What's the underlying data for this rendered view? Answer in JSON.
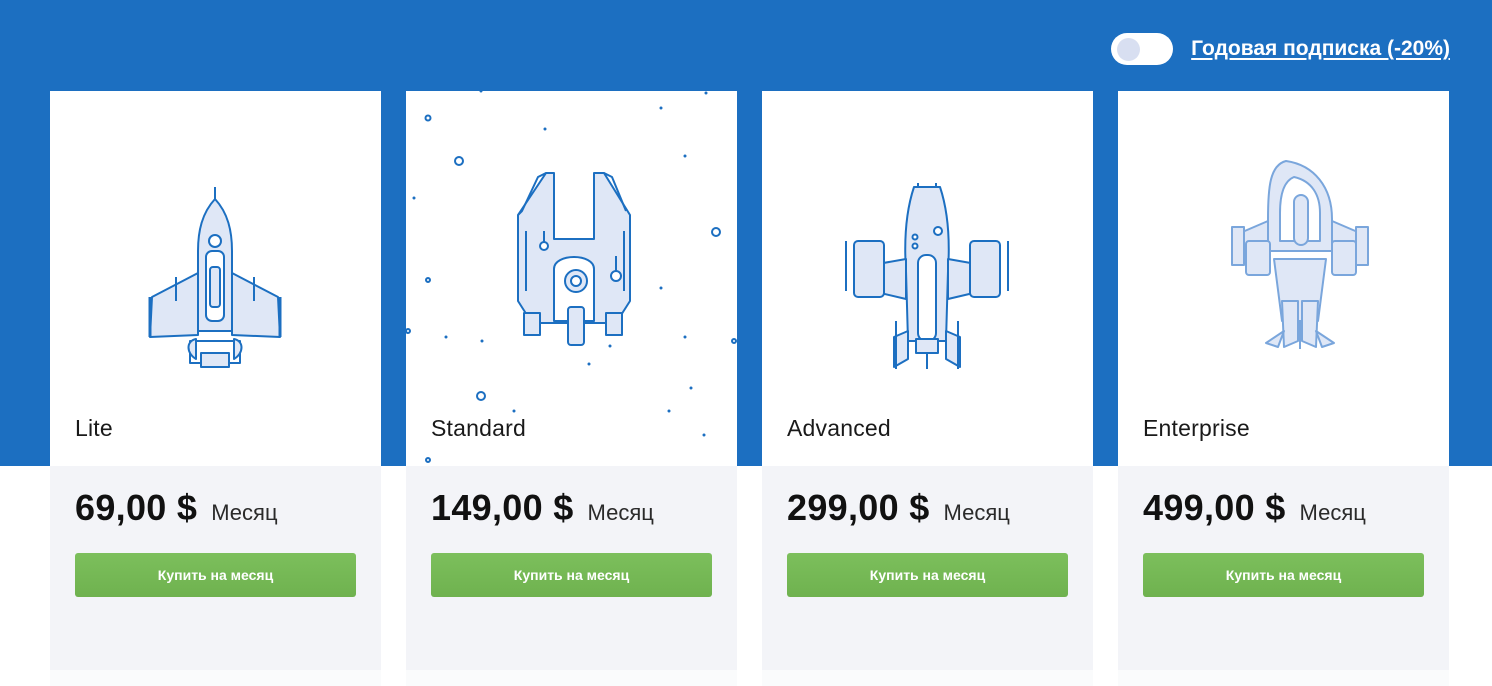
{
  "header": {
    "annual_toggle_on": false,
    "annual_label": "Годовая подписка (-20%)"
  },
  "colors": {
    "brand_blue": "#1c6fc1",
    "button_green": "#74b854",
    "card_bottom": "#f3f4f8"
  },
  "plans": [
    {
      "name": "Lite",
      "price": "69,00 $",
      "period": "Месяц",
      "button": "Купить на месяц",
      "icon": "rocket-ship-icon"
    },
    {
      "name": "Standard",
      "price": "149,00 $",
      "period": "Месяц",
      "button": "Купить на месяц",
      "icon": "fork-spaceship-icon"
    },
    {
      "name": "Advanced",
      "price": "299,00 $",
      "period": "Месяц",
      "button": "Купить на месяц",
      "icon": "cargo-spaceship-icon"
    },
    {
      "name": "Enterprise",
      "price": "499,00 $",
      "period": "Месяц",
      "button": "Купить на месяц",
      "icon": "mothership-icon"
    }
  ]
}
